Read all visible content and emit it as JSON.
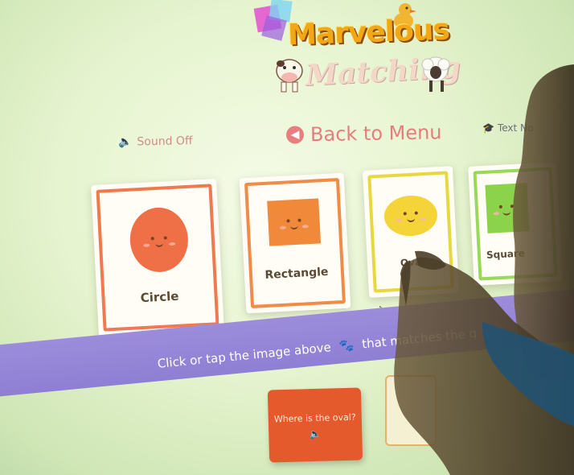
{
  "app": {
    "logo_line1": "Marvelous",
    "logo_line2": "Matching"
  },
  "toolbar": {
    "sound_label": "Sound Off",
    "back_label": "Back to Menu",
    "text_label": "Text No"
  },
  "cards": [
    {
      "label": "Circle",
      "shape": "circle",
      "color": "#ef7046",
      "border": "#ef7a4f"
    },
    {
      "label": "Rectangle",
      "shape": "rectangle",
      "color": "#f08a3a",
      "border": "#f08c47"
    },
    {
      "label": "Oval",
      "shape": "oval",
      "color": "#f5d43a",
      "border": "#e7d83f"
    },
    {
      "label": "Square",
      "shape": "square",
      "color": "#8bd34a",
      "border": "#9ad85a"
    }
  ],
  "instruction": {
    "part1": "Click or tap the image above",
    "part2": "that matches the q"
  },
  "question": {
    "text": "Where is the oval?"
  },
  "colors": {
    "band": "#9c8ddb",
    "question_bg": "#e55a2c",
    "back_accent": "#e67d7d"
  }
}
